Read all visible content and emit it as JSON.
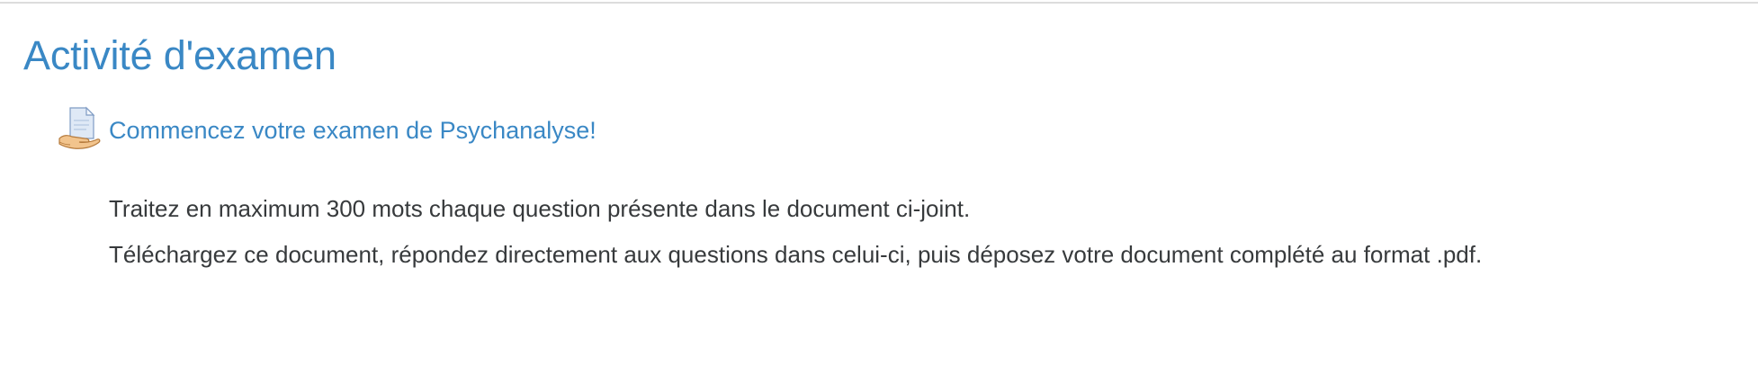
{
  "section": {
    "title": "Activité d'examen"
  },
  "activity": {
    "icon": "assignment-icon",
    "link_label": "Commencez votre examen de Psychanalyse!",
    "link_color": "#3a88c5",
    "description": [
      "Traitez en maximum 300 mots chaque question présente dans le document ci-joint.",
      "Téléchargez ce document, répondez directement aux questions dans celui-ci, puis déposez votre document complété au format .pdf."
    ]
  }
}
